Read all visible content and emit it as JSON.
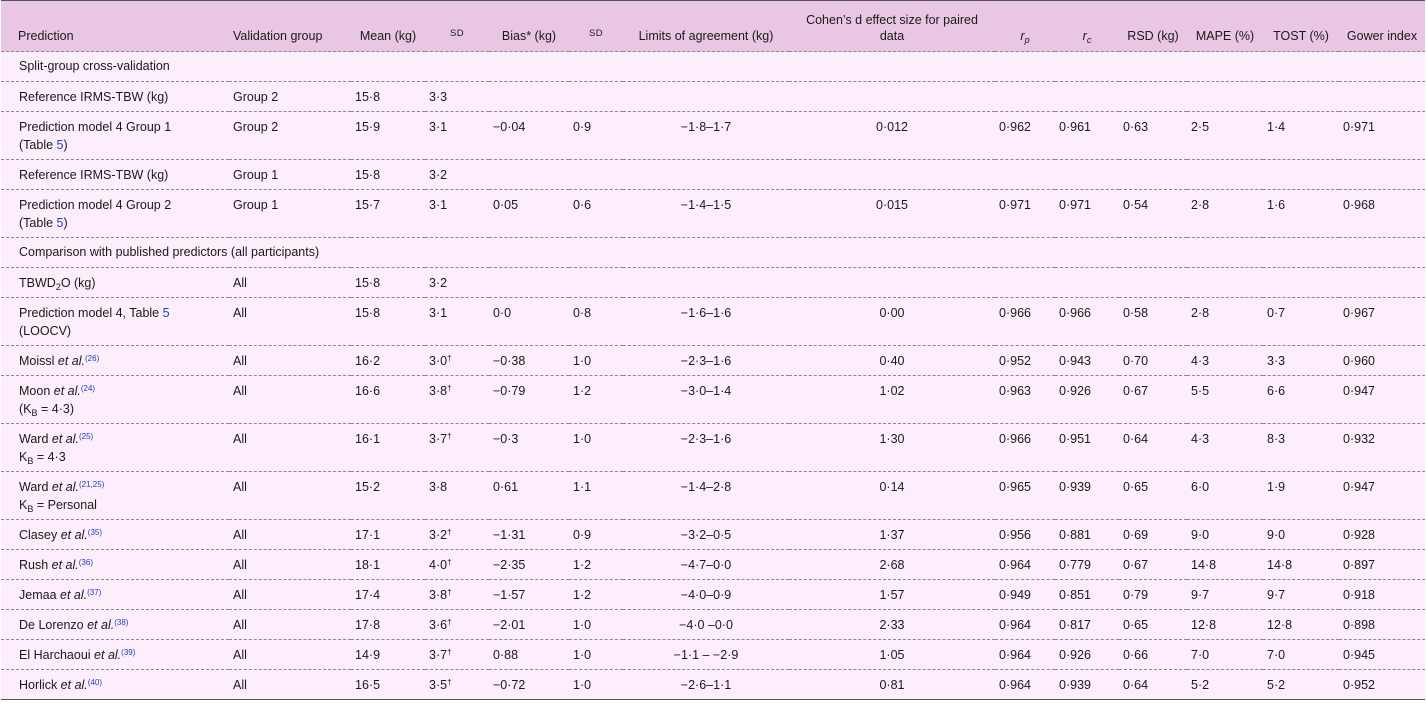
{
  "headers": {
    "prediction": "Prediction",
    "validation_group": "Validation group",
    "mean": "Mean (kg)",
    "sd": "SD",
    "bias": "Bias* (kg)",
    "sd2": "SD",
    "limits": "Limits of agreement (kg)",
    "cohen": "Cohen’s d effect size for paired data",
    "rp_main": "r",
    "rp_sub": "p",
    "rc_main": "r",
    "rc_sub": "c",
    "rsd": "RSD (kg)",
    "mape": "MAPE (%)",
    "tost": "TOST (%)",
    "gower": "Gower index"
  },
  "sections": {
    "split": "Split-group cross-validation",
    "published": "Comparison with published predictors (all participants)"
  },
  "rows": {
    "r1": {
      "line1": "Reference IRMS-TBW (kg)",
      "group": "Group 2",
      "mean": "15·8",
      "sd": "3·3"
    },
    "r2": {
      "line1": "Prediction model 4 Group 1",
      "line2a": "(Table ",
      "ref": "5",
      "line2b": ")",
      "group": "Group 2",
      "mean": "15·9",
      "sd": "3·1",
      "bias": "−0·04",
      "sd2": "0·9",
      "loa": "−1·8–1·7",
      "cohen": "0·012",
      "rp": "0·962",
      "rc": "0·961",
      "rsd": "0·63",
      "mape": "2·5",
      "tost": "1·4",
      "gower": "0·971"
    },
    "r3": {
      "line1": "Reference IRMS-TBW (kg)",
      "group": "Group 1",
      "mean": "15·8",
      "sd": "3·2"
    },
    "r4": {
      "line1": "Prediction model 4 Group 2",
      "line2a": "(Table ",
      "ref": "5",
      "line2b": ")",
      "group": "Group 1",
      "mean": "15·7",
      "sd": "3·1",
      "bias": "0·05",
      "sd2": "0·6",
      "loa": "−1·4–1·5",
      "cohen": "0·015",
      "rp": "0·971",
      "rc": "0·971",
      "rsd": "0·54",
      "mape": "2·8",
      "tost": "1·6",
      "gower": "0·968"
    },
    "r5": {
      "pre": "TBWD",
      "sub": "2",
      "post": "O (kg)",
      "group": "All",
      "mean": "15·8",
      "sd": "3·2"
    },
    "r6": {
      "line1a": "Prediction model 4, Table ",
      "ref": "5",
      "line2": "(LOOCV)",
      "group": "All",
      "mean": "15·8",
      "sd": "3·1",
      "bias": "0·0",
      "sd2": "0·8",
      "loa": "−1·6–1·6",
      "cohen": "0·00",
      "rp": "0·966",
      "rc": "0·966",
      "rsd": "0·58",
      "mape": "2·8",
      "tost": "0·7",
      "gower": "0·967"
    },
    "r7": {
      "author": "Moissl ",
      "etal": "et al.",
      "cite": "(26)",
      "group": "All",
      "mean": "16·2",
      "sd": "3·0",
      "dag": "†",
      "bias": "−0·38",
      "sd2": "1·0",
      "loa": "−2·3–1·6",
      "cohen": "0·40",
      "rp": "0·952",
      "rc": "0·943",
      "rsd": "0·70",
      "mape": "4·3",
      "tost": "3·3",
      "gower": "0·960"
    },
    "r8": {
      "author": "Moon ",
      "etal": "et al.",
      "cite": "(24)",
      "l2pre": "(K",
      "l2sub": "B",
      "l2post": " = 4·3)",
      "group": "All",
      "mean": "16·6",
      "sd": "3·8",
      "dag": "†",
      "bias": "−0·79",
      "sd2": "1·2",
      "loa": "−3·0–1·4",
      "cohen": "1·02",
      "rp": "0·963",
      "rc": "0·926",
      "rsd": "0·67",
      "mape": "5·5",
      "tost": "6·6",
      "gower": "0·947"
    },
    "r9": {
      "author": "Ward ",
      "etal": "et al.",
      "cite": "(25)",
      "l2pre": "K",
      "l2sub": "B",
      "l2post": " = 4·3",
      "group": "All",
      "mean": "16·1",
      "sd": "3·7",
      "dag": "†",
      "bias": "−0·3",
      "sd2": "1·0",
      "loa": "−2·3–1·6",
      "cohen": "1·30",
      "rp": "0·966",
      "rc": "0·951",
      "rsd": "0·64",
      "mape": "4·3",
      "tost": "8·3",
      "gower": "0·932"
    },
    "r10": {
      "author": "Ward ",
      "etal": "et al.",
      "cite": "(21,25)",
      "l2pre": "K",
      "l2sub": "B",
      "l2post": " = Personal",
      "group": "All",
      "mean": "15·2",
      "sd": "3·8",
      "bias": "0·61",
      "sd2": "1·1",
      "loa": "−1·4–2·8",
      "cohen": "0·14",
      "rp": "0·965",
      "rc": "0·939",
      "rsd": "0·65",
      "mape": "6·0",
      "tost": "1·9",
      "gower": "0·947"
    },
    "r11": {
      "author": "Clasey ",
      "etal": "et al.",
      "cite": "(35)",
      "group": "All",
      "mean": "17·1",
      "sd": "3·2",
      "dag": "†",
      "bias": "−1·31",
      "sd2": "0·9",
      "loa": "−3·2–0·5",
      "cohen": "1·37",
      "rp": "0·956",
      "rc": "0·881",
      "rsd": "0·69",
      "mape": "9·0",
      "tost": "9·0",
      "gower": "0·928"
    },
    "r12": {
      "author": "Rush ",
      "etal": "et al.",
      "cite": "(36)",
      "group": "All",
      "mean": "18·1",
      "sd": "4·0",
      "dag": "†",
      "bias": "−2·35",
      "sd2": "1·2",
      "loa": "−4·7–0·0",
      "cohen": "2·68",
      "rp": "0·964",
      "rc": "0·779",
      "rsd": "0·67",
      "mape": "14·8",
      "tost": "14·8",
      "gower": "0·897"
    },
    "r13": {
      "author": "Jemaa ",
      "etal": "et al.",
      "cite": "(37)",
      "group": "All",
      "mean": "17·4",
      "sd": "3·8",
      "dag": "†",
      "bias": "−1·57",
      "sd2": "1·2",
      "loa": "−4·0–0·9",
      "cohen": "1·57",
      "rp": "0·949",
      "rc": "0·851",
      "rsd": "0·79",
      "mape": "9·7",
      "tost": "9·7",
      "gower": "0·918"
    },
    "r14": {
      "author": "De Lorenzo ",
      "etal": "et al.",
      "cite": "(38)",
      "group": "All",
      "mean": "17·8",
      "sd": "3·6",
      "dag": "†",
      "bias": "−2·01",
      "sd2": "1·0",
      "loa": "−4·0 –0·0",
      "cohen": "2·33",
      "rp": "0·964",
      "rc": "0·817",
      "rsd": "0·65",
      "mape": "12·8",
      "tost": "12·8",
      "gower": "0·898"
    },
    "r15": {
      "author": "El Harchaoui ",
      "etal": "et al.",
      "cite": "(39)",
      "group": "All",
      "mean": "14·9",
      "sd": "3·7",
      "dag": "†",
      "bias": "0·88",
      "sd2": "1·0",
      "loa": "−1·1 – −2·9",
      "cohen": "1·05",
      "rp": "0·964",
      "rc": "0·926",
      "rsd": "0·66",
      "mape": "7·0",
      "tost": "7·0",
      "gower": "0·945"
    },
    "r16": {
      "author": "Horlick ",
      "etal": "et al.",
      "cite": "(40)",
      "group": "All",
      "mean": "16·5",
      "sd": "3·5",
      "dag": "†",
      "bias": "−0·72",
      "sd2": "1·0",
      "loa": "−2·6–1·1",
      "cohen": "0·81",
      "rp": "0·964",
      "rc": "0·939",
      "rsd": "0·64",
      "mape": "5·2",
      "tost": "5·2",
      "gower": "0·952"
    }
  }
}
